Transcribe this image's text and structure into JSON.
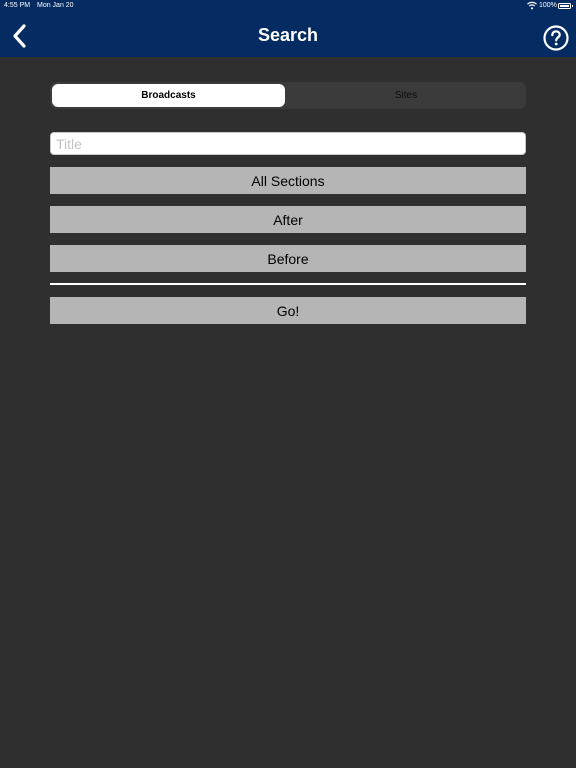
{
  "status_bar": {
    "time": "4:55 PM",
    "date": "Mon Jan 20",
    "battery": "100%",
    "wifi_icon": "wifi-icon",
    "battery_icon": "battery-full-icon"
  },
  "nav": {
    "title": "Search",
    "back_icon": "chevron-left-icon",
    "help_icon": "question-circle-icon",
    "bar_color": "#052c62"
  },
  "segments": {
    "broadcasts": "Broadcasts",
    "sites": "Sites",
    "selected": "Broadcasts"
  },
  "search": {
    "title_placeholder": "Title",
    "title_value": ""
  },
  "buttons": {
    "sections": "All Sections",
    "after": "After",
    "before": "Before",
    "go": "Go!"
  },
  "colors": {
    "background": "#2f2f2f",
    "button": "#b5b5b5"
  }
}
